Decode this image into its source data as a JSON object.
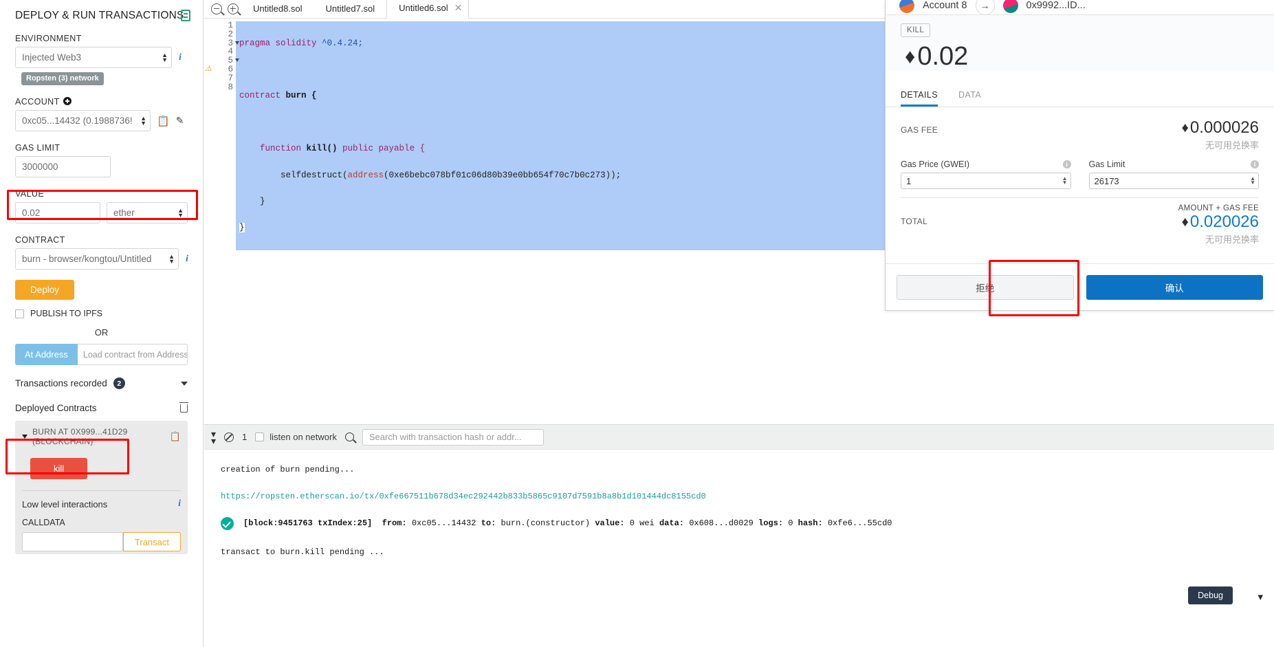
{
  "sidebar": {
    "title": "DEPLOY & RUN TRANSACTIONS",
    "environment_label": "ENVIRONMENT",
    "environment_value": "Injected Web3",
    "network_badge": "Ropsten (3) network",
    "account_label": "ACCOUNT",
    "account_value": "0xc05...14432 (0.1988736!",
    "gas_limit_label": "GAS LIMIT",
    "gas_limit_value": "3000000",
    "value_label": "VALUE",
    "value_amount": "0.02",
    "value_unit": "ether",
    "contract_label": "CONTRACT",
    "contract_value": "burn - browser/kongtou/Untitled",
    "deploy_button": "Deploy",
    "publish_ipfs": "PUBLISH TO IPFS",
    "or_text": "OR",
    "at_address_button": "At Address",
    "at_address_placeholder": "Load contract from Address",
    "transactions_recorded": "Transactions recorded",
    "transactions_count": "2",
    "deployed_contracts": "Deployed Contracts",
    "deployed_item": "BURN AT 0X999...41D29 (BLOCKCHAIN)",
    "kill_button": "kill",
    "low_level": "Low level interactions",
    "calldata_label": "CALLDATA",
    "calldata_value": "",
    "transact_button": "Transact"
  },
  "editor": {
    "tabs": [
      {
        "label": "Untitled8.sol",
        "active": false,
        "closable": false
      },
      {
        "label": "Untitled7.sol",
        "active": false,
        "closable": false
      },
      {
        "label": "Untitled6.sol",
        "active": true,
        "closable": true
      }
    ],
    "lines": [
      {
        "n": "1",
        "fold": false,
        "warn": false
      },
      {
        "n": "2",
        "fold": false,
        "warn": false
      },
      {
        "n": "3",
        "fold": true,
        "warn": false
      },
      {
        "n": "4",
        "fold": false,
        "warn": false
      },
      {
        "n": "5",
        "fold": true,
        "warn": false
      },
      {
        "n": "6",
        "fold": false,
        "warn": true
      },
      {
        "n": "7",
        "fold": false,
        "warn": false
      },
      {
        "n": "8",
        "fold": false,
        "warn": false
      }
    ],
    "code": {
      "l1_kw": "pragma solidity ",
      "l1_ver": "^0.4.24;",
      "l3_kw": "contract ",
      "l3_name": "burn {",
      "l5_kw": "function ",
      "l5_name": "kill() ",
      "l5_mod": "public payable {",
      "l6_call": "        selfdestruct(",
      "l6_type": "address",
      "l6_addr": "(0xe6bebc078bf01c06d80b39e0bb654f70c7b0c273));",
      "l7": "    }",
      "l8": "}"
    }
  },
  "terminal": {
    "count": "1",
    "listen_label": "listen on network",
    "search_placeholder": "Search with transaction hash or addr...",
    "pending_line": "creation of burn pending...",
    "etherscan_url": "https://ropsten.etherscan.io/tx/0xfe667511b678d34ec292442b833b5865c9107d7591b8a8b1d101444dc8155cd0",
    "log": {
      "block": "[block:9451763 txIndex:25]",
      "from_label": "from:",
      "from_value": "0xc05...14432",
      "to_label": "to:",
      "to_value": "burn.(constructor)",
      "value_label": "value:",
      "value_value": "0 wei",
      "data_label": "data:",
      "data_value": "0x608...d0029",
      "logs_label": "logs:",
      "logs_value": "0",
      "hash_label": "hash:",
      "hash_value": "0xfe6...55cd0"
    },
    "kill_pending": "transact to burn.kill pending ...",
    "debug_button": "Debug"
  },
  "metamask": {
    "account_name": "Account 8",
    "recipient": "0x9992...ID...",
    "method_badge": "KILL",
    "amount": "0.02",
    "eth_symbol": "♦",
    "tab_details": "DETAILS",
    "tab_data": "DATA",
    "gas_fee_label": "GAS FEE",
    "gas_fee_value": "0.000026",
    "no_rate": "无可用兑换率",
    "gas_price_label": "Gas Price (GWEI)",
    "gas_price_value": "1",
    "gas_limit_label": "Gas Limit",
    "gas_limit_value": "26173",
    "amount_gas_label": "AMOUNT + GAS FEE",
    "total_label": "TOTAL",
    "total_value": "0.020026",
    "reject_button": "拒绝",
    "confirm_button": "确认"
  },
  "colors": {
    "deploy": "#f5a623",
    "kill": "#e9503f",
    "confirm": "#0b72c4",
    "highlight": "#fb0000",
    "link": "#17a09a",
    "code_bg": "#aeccf7"
  }
}
